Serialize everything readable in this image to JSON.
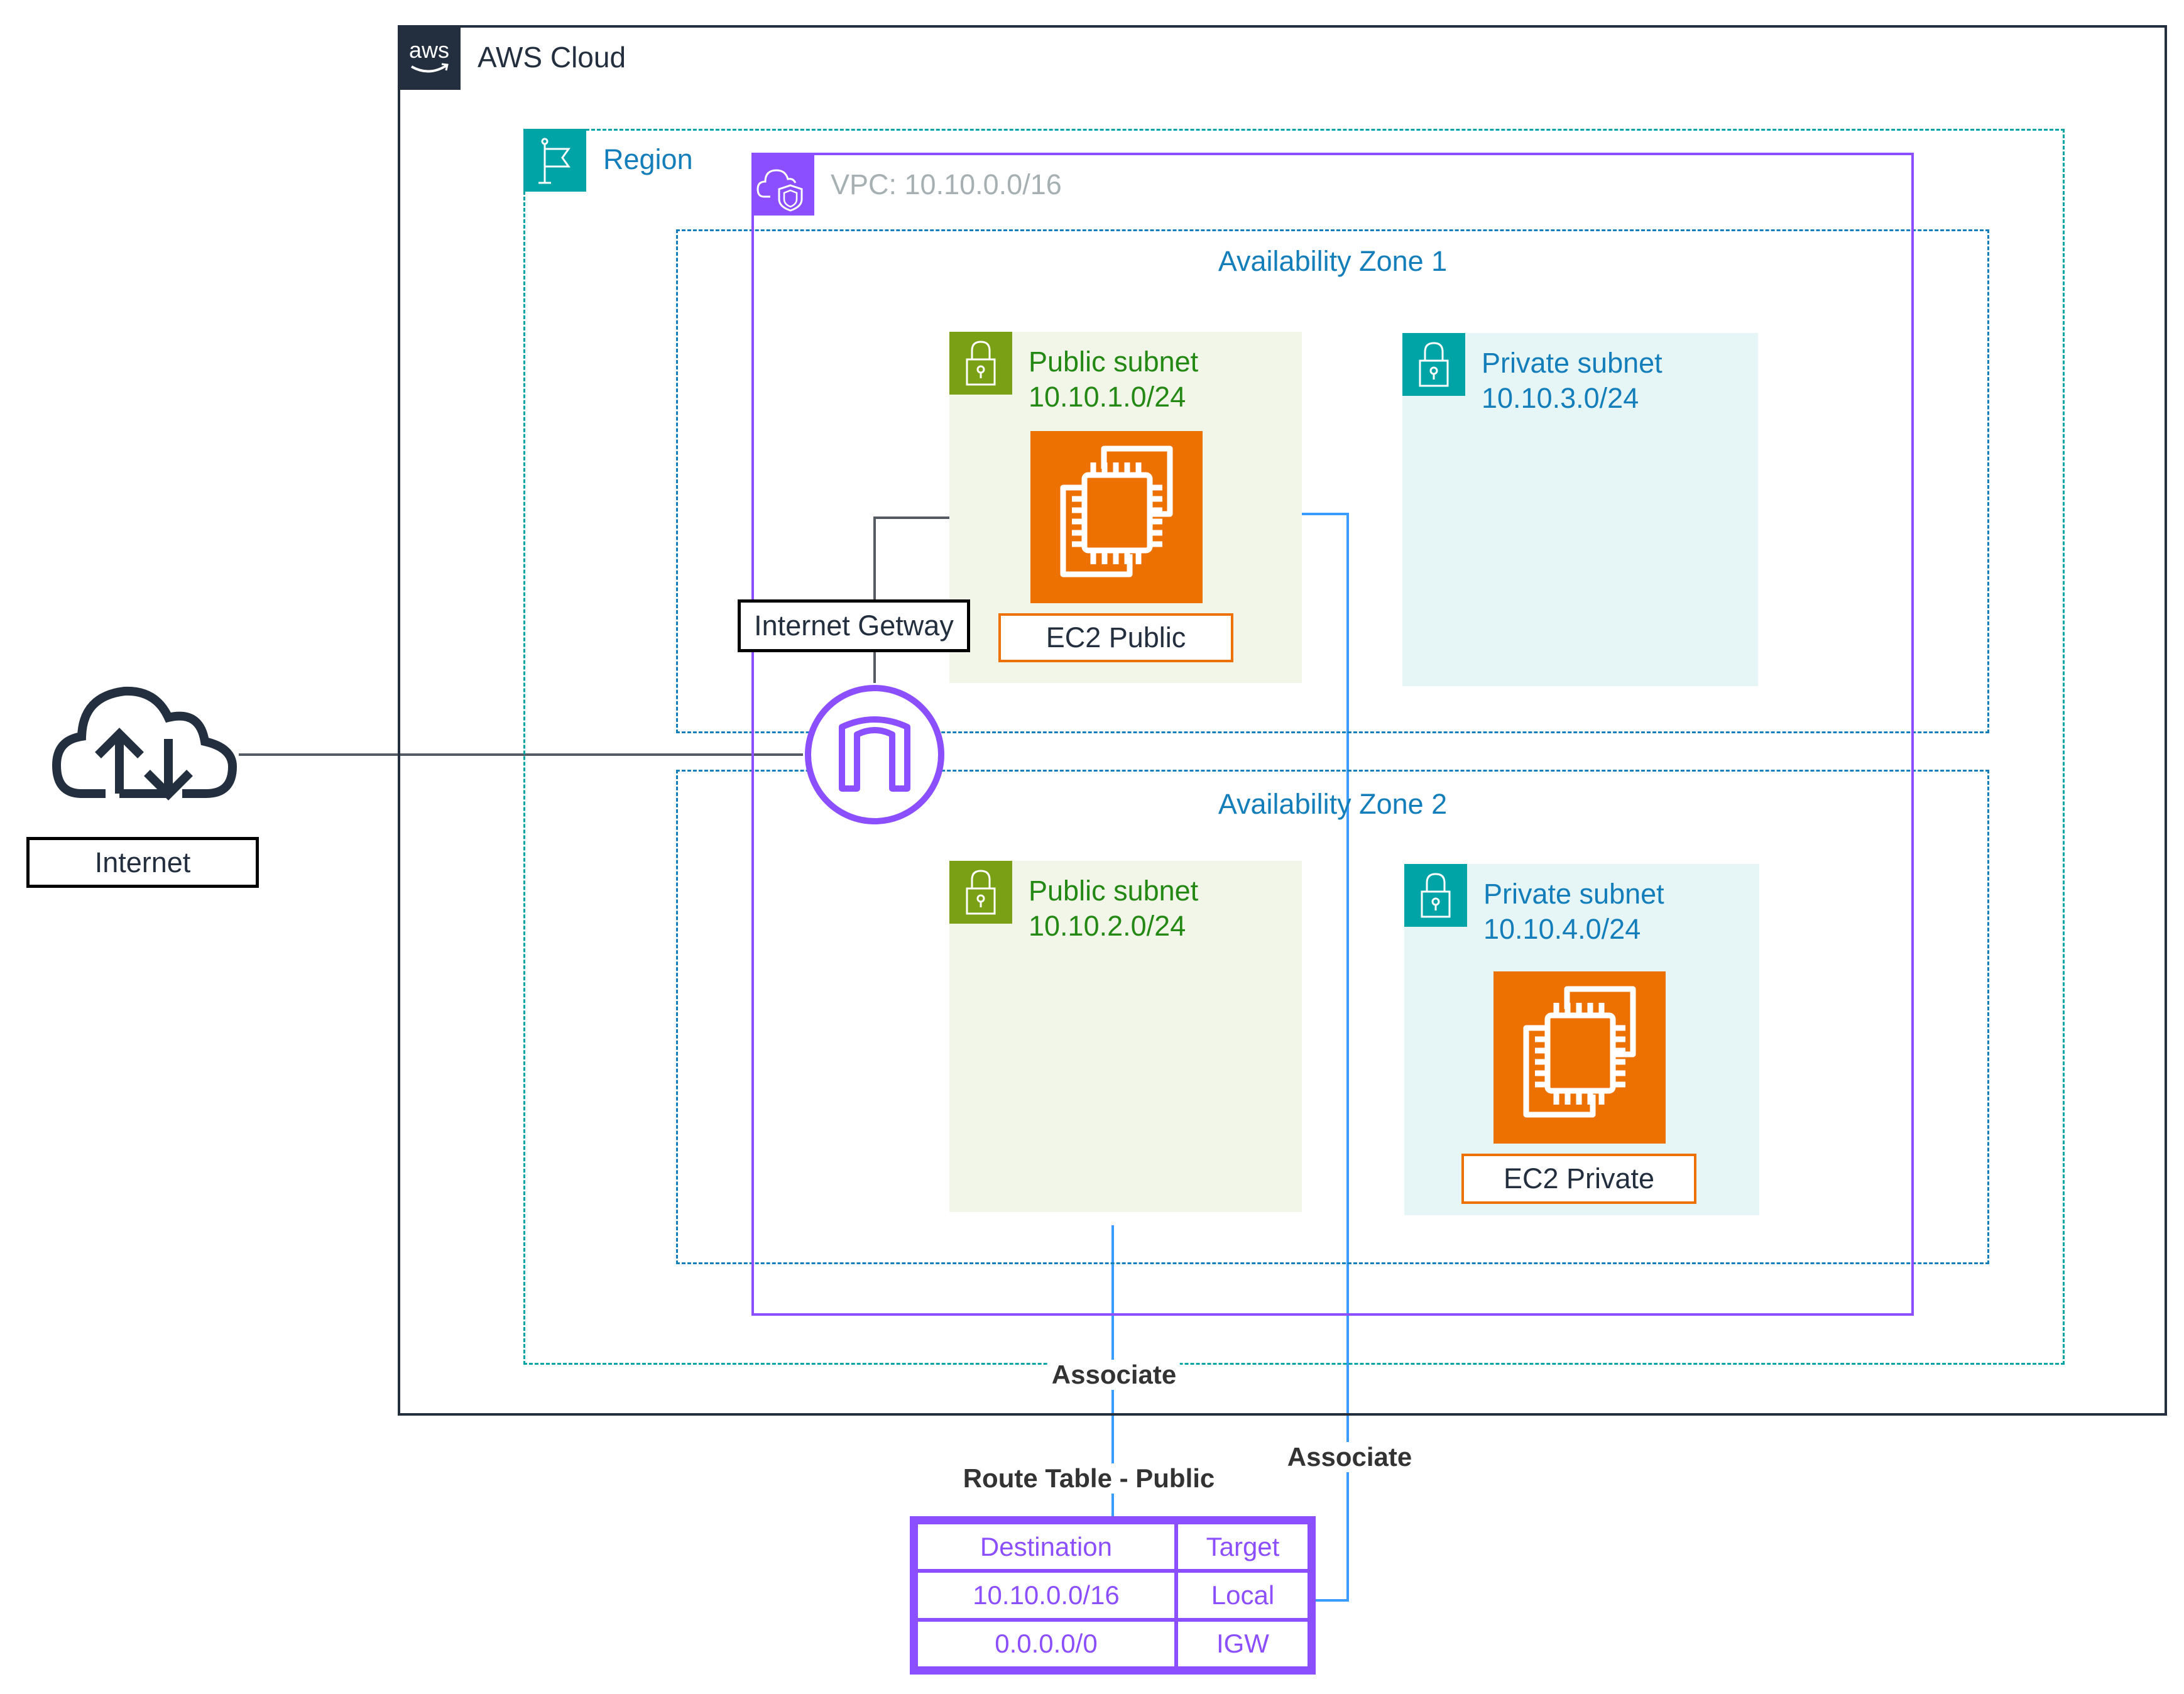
{
  "aws_cloud": {
    "title": "AWS Cloud",
    "icon": "aws-logo-icon"
  },
  "region": {
    "title": "Region",
    "icon": "region-flag-icon"
  },
  "vpc": {
    "title": "VPC: 10.10.0.0/16",
    "icon": "vpc-cloud-shield-icon"
  },
  "availability_zones": [
    {
      "title": "Availability Zone 1"
    },
    {
      "title": "Availability Zone 2"
    }
  ],
  "subnets": [
    {
      "name": "Public subnet",
      "cidr": "10.10.1.0/24",
      "type": "public",
      "icon": "lock-icon"
    },
    {
      "name": "Private subnet",
      "cidr": "10.10.3.0/24",
      "type": "private",
      "icon": "lock-icon"
    },
    {
      "name": "Public subnet",
      "cidr": "10.10.2.0/24",
      "type": "public",
      "icon": "lock-icon"
    },
    {
      "name": "Private subnet",
      "cidr": "10.10.4.0/24",
      "type": "private",
      "icon": "lock-icon"
    }
  ],
  "instances": [
    {
      "label": "EC2 Public",
      "icon": "ec2-instance-icon"
    },
    {
      "label": "EC2 Private",
      "icon": "ec2-instance-icon"
    }
  ],
  "internet_gateway": {
    "label": "Internet Getway",
    "icon": "internet-gateway-icon"
  },
  "internet": {
    "label": "Internet",
    "icon": "cloud-upload-download-icon"
  },
  "associations": [
    {
      "label": "Associate"
    },
    {
      "label": "Associate"
    }
  ],
  "route_table": {
    "title": "Route Table - Public",
    "headers": [
      "Destination",
      "Target"
    ],
    "rows": [
      [
        "10.10.0.0/16",
        "Local"
      ],
      [
        "0.0.0.0/0",
        "IGW"
      ]
    ]
  },
  "colors": {
    "aws_dark": "#232f3e",
    "region_teal": "#00a4a6",
    "vpc_purple": "#8c4fff",
    "az_blue": "#147eba",
    "public_green": "#7aa116",
    "public_text": "#248814",
    "ec2_orange": "#ed7100",
    "connector_blue": "#3b9cff",
    "connector_gray": "#545b64"
  }
}
